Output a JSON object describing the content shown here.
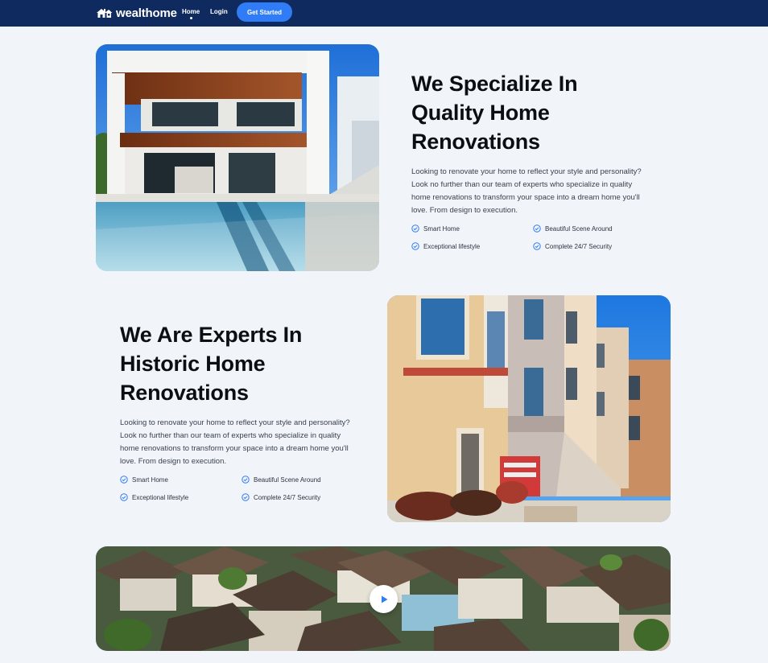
{
  "brand": {
    "name": "wealthome",
    "icon": "house-logo-icon"
  },
  "nav": {
    "home": "Home",
    "login": "Login",
    "cta": "Get Started"
  },
  "colors": {
    "nav_bg": "#0f2a5f",
    "accent": "#2f7cf6",
    "page_bg": "#f1f4f9"
  },
  "section1": {
    "heading": [
      "We Specialize In",
      "Quality Home",
      "Renovations"
    ],
    "description": "Looking to renovate your home to reflect your style and personality? Look no further than our team of experts who specialize in quality home renovations to transform your space into a dream home you'll love. From design to execution.",
    "features": [
      "Smart Home",
      "Beautiful Scene Around",
      "Exceptional lifestyle",
      "Complete 24/7 Security"
    ]
  },
  "section2": {
    "heading": [
      "We Are Experts In",
      "Historic Home",
      "Renovations"
    ],
    "description": "Looking to renovate your home to reflect your style and personality? Look no further than our team of experts who specialize in quality home renovations to transform your space into a dream home you'll love. From design to execution.",
    "features": [
      "Smart Home",
      "Beautiful Scene Around",
      "Exceptional lifestyle",
      "Complete 24/7 Security"
    ]
  },
  "video": {
    "icon": "play-icon"
  }
}
